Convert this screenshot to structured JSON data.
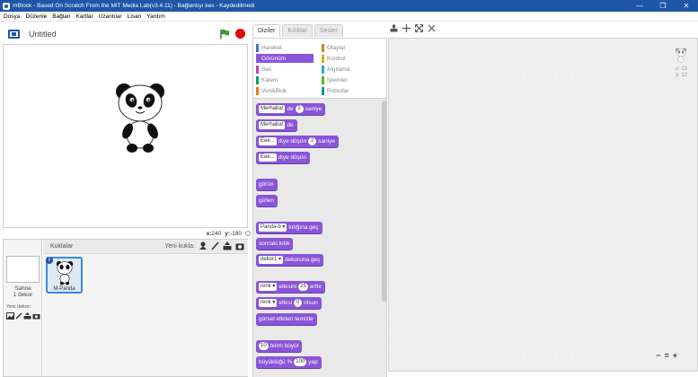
{
  "window": {
    "title": "mBlock - Based On Scratch From the MIT Media Lab(v3.4.11) - Bağlantıyı kes - Kaydedilmedi",
    "minimize": "—",
    "maximize": "❐",
    "close": "✕"
  },
  "menu": [
    "Dosya",
    "Düzenle",
    "Bağlan",
    "Kartlar",
    "Uzantılar",
    "Lisan",
    "Yardım"
  ],
  "stage": {
    "project_title": "Untitled",
    "x_label": "x:",
    "x_value": "240",
    "y_label": "y:",
    "y_value": "-180"
  },
  "sprites_panel": {
    "header": "Kuklalar",
    "new_sprite_label": "Yeni kukla:",
    "stage_label_1": "Sahne",
    "stage_label_2": "1 dekor",
    "new_decor_label": "Yeni dekor:",
    "sprite_name": "M-Panda",
    "info": "i"
  },
  "tabs": [
    "Diziler",
    "Kılıklar",
    "Sesler"
  ],
  "categories": [
    {
      "label": "Hareket",
      "color": "#4a6cd4",
      "selected": false
    },
    {
      "label": "Olaylar",
      "color": "#c88330",
      "selected": false
    },
    {
      "label": "Görünüm",
      "color": "#8a55d7",
      "selected": true
    },
    {
      "label": "Kontrol",
      "color": "#e1a91a",
      "selected": false
    },
    {
      "label": "Ses",
      "color": "#bb42c3",
      "selected": false
    },
    {
      "label": "Algılama",
      "color": "#2ca5e2",
      "selected": false
    },
    {
      "label": "Kalem",
      "color": "#0e9a6c",
      "selected": false
    },
    {
      "label": "İşlemler",
      "color": "#5cb712",
      "selected": false
    },
    {
      "label": "Veri&Blok",
      "color": "#ee7d16",
      "selected": false
    },
    {
      "label": "Robotlar",
      "color": "#0e9a9a",
      "selected": false
    }
  ],
  "blocks": {
    "b1_input": "Merhaba!",
    "b1_t1": "de",
    "b1_num": "2",
    "b1_t2": "saniye",
    "b2_input": "Merhaba!",
    "b2_t1": "de",
    "b3_input": "Eee...",
    "b3_t1": "diye düşün",
    "b3_num": "2",
    "b3_t2": "saniye",
    "b4_input": "Eee...",
    "b4_t1": "diye düşün",
    "b5": "görün",
    "b6": "gizlen",
    "b7_dd": "Panda-b ▾",
    "b7_t1": "kılığına geç",
    "b8": "sonraki kılık",
    "b9_dd": "dekor1 ▾",
    "b9_t1": "dekoruna geç",
    "b10_dd": "renk ▾",
    "b10_t1": "etkisini",
    "b10_num": "25",
    "b10_t2": "arttır",
    "b11_dd": "renk ▾",
    "b11_t1": "etkisi",
    "b11_num": "0",
    "b11_t2": "olsun",
    "b12": "görsel etkileri temizle",
    "b13_num": "10",
    "b13_t1": "birim büyüt",
    "b14_t1": "büyüklüğü %",
    "b14_num": "100",
    "b14_t2": "yap"
  },
  "script_area": {
    "x_label": "x: 23",
    "y_label": "y: 12",
    "zoom_out": "−",
    "zoom_reset": "=",
    "zoom_in": "+"
  },
  "colors": {
    "looks": "#8a55d7",
    "accent": "#1e56a8",
    "stop": "#e00000",
    "flag": "#2e7d32"
  }
}
